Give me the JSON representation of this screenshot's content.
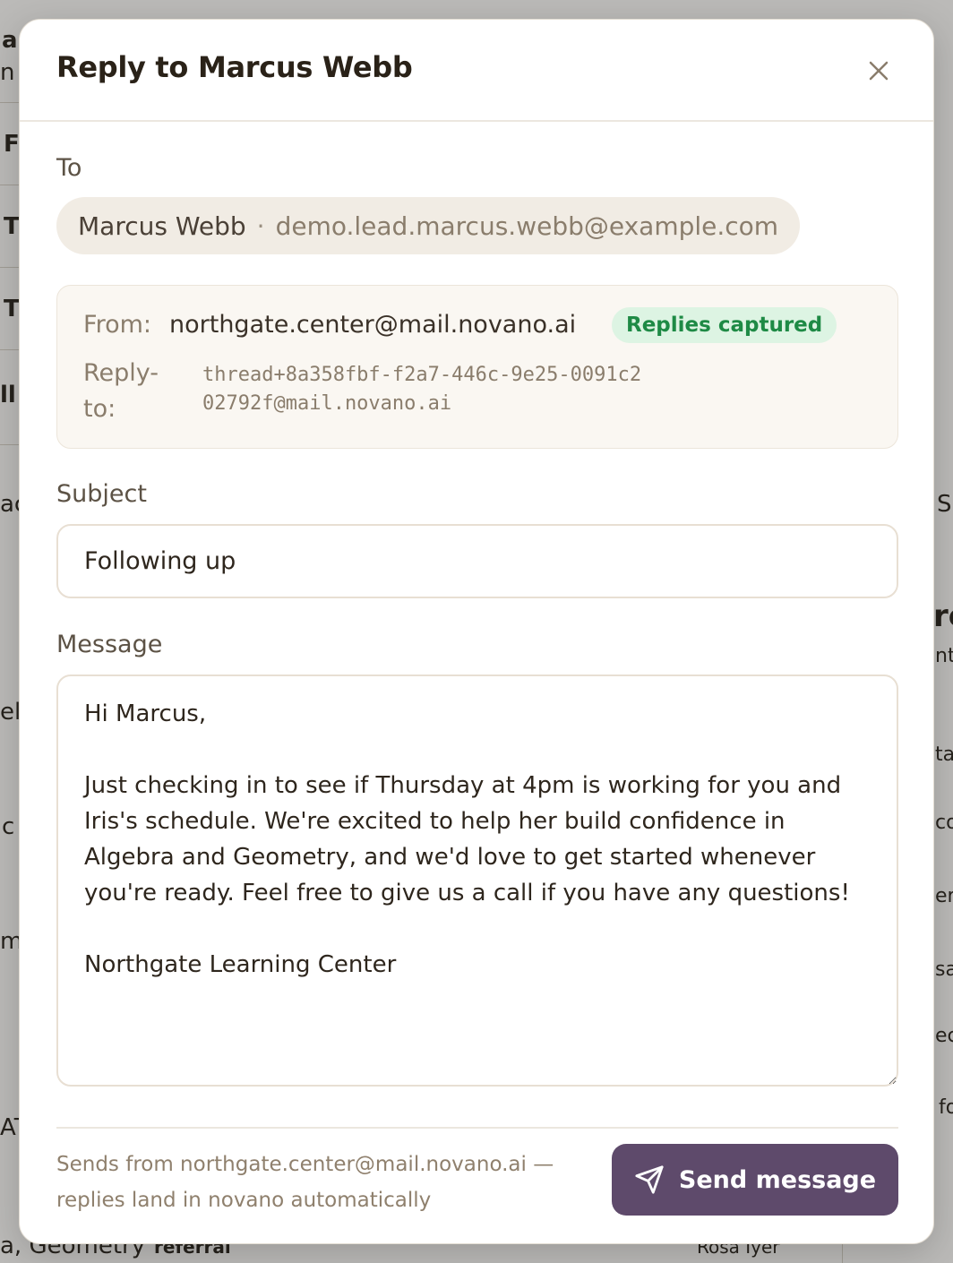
{
  "modal": {
    "title": "Reply to Marcus Webb"
  },
  "to": {
    "label": "To",
    "name": "Marcus Webb",
    "separator": "·",
    "email": "demo.lead.marcus.webb@example.com"
  },
  "from": {
    "label": "From:",
    "address": "northgate.center@mail.novano.ai",
    "badge": "Replies captured",
    "reply_to_label": "Reply-to:",
    "reply_to_address": "thread+8a358fbf-f2a7-446c-9e25-0091c202792f@mail.novano.ai"
  },
  "subject": {
    "label": "Subject",
    "value": "Following up"
  },
  "message": {
    "label": "Message",
    "body": "Hi Marcus,\n\nJust checking in to see if Thursday at 4pm is working for you and Iris's schedule. We're excited to help her build confidence in Algebra and Geometry, and we'd love to get started whenever you're ready. Feel free to give us a call if you have any questions!\n\nNorthgate Learning Center"
  },
  "footer": {
    "note": "Sends from northgate.center@mail.novano.ai — replies land in novano automatically",
    "send_label": "Send message"
  },
  "background": {
    "fragments": [
      "a",
      "n y",
      "F",
      "T",
      "T",
      "ll",
      "ac",
      "el",
      "c",
      "mi",
      "AT",
      "a, Geometry",
      "referral",
      "Rosa Iyer",
      "S",
      "rc",
      "nt",
      "ta",
      "co",
      "er",
      "sa",
      "ec",
      "fo"
    ]
  },
  "colors": {
    "accent": "#5e4a6b",
    "badge_bg": "#ddf4e3",
    "badge_text": "#1e8a45"
  }
}
